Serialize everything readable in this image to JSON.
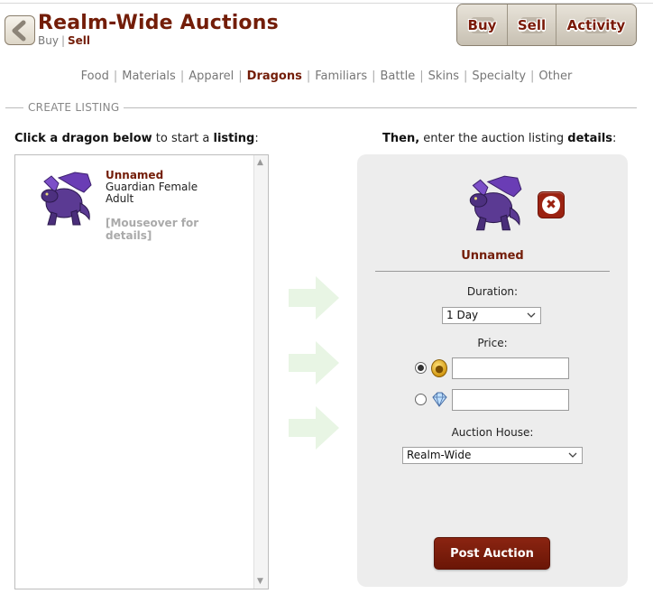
{
  "header": {
    "title": "Realm-Wide Auctions",
    "subnav": {
      "buy": "Buy",
      "separator": "|",
      "sell": "Sell"
    },
    "buttons": [
      "Buy",
      "Sell",
      "Activity"
    ]
  },
  "categories": {
    "items": [
      "Food",
      "Materials",
      "Apparel",
      "Dragons",
      "Familiars",
      "Battle",
      "Skins",
      "Specialty",
      "Other"
    ],
    "active": "Dragons"
  },
  "section": {
    "label": "CREATE LISTING"
  },
  "instructions": {
    "left": {
      "bold1": "Click a dragon below",
      "mid": " to start a ",
      "bold2": "listing",
      "end": ":"
    },
    "right": {
      "bold1": "Then,",
      "mid": " enter the auction listing ",
      "bold2": "details",
      "end": ":"
    }
  },
  "dragon_list": [
    {
      "name": "Unnamed",
      "breed": "Guardian Female",
      "age": "Adult",
      "hint": "[Mouseover for details]"
    }
  ],
  "listing": {
    "dragon_name": "Unnamed",
    "duration_label": "Duration:",
    "duration_value": "1 Day",
    "price_label": "Price:",
    "currency_selected": "treasure",
    "house_label": "Auction House:",
    "house_value": "Realm-Wide",
    "post_label": "Post Auction"
  },
  "icons": {
    "back": "chevron-left-icon",
    "remove": "close-icon",
    "treasure": "treasure-coin-icon",
    "gems": "gem-icon",
    "arrow": "arrow-right-icon"
  },
  "colors": {
    "brand": "#731d08",
    "button": "#7a1a08",
    "panel": "#ededed",
    "arrow": "#e8f5e4",
    "dragon": "#5b3a93"
  }
}
